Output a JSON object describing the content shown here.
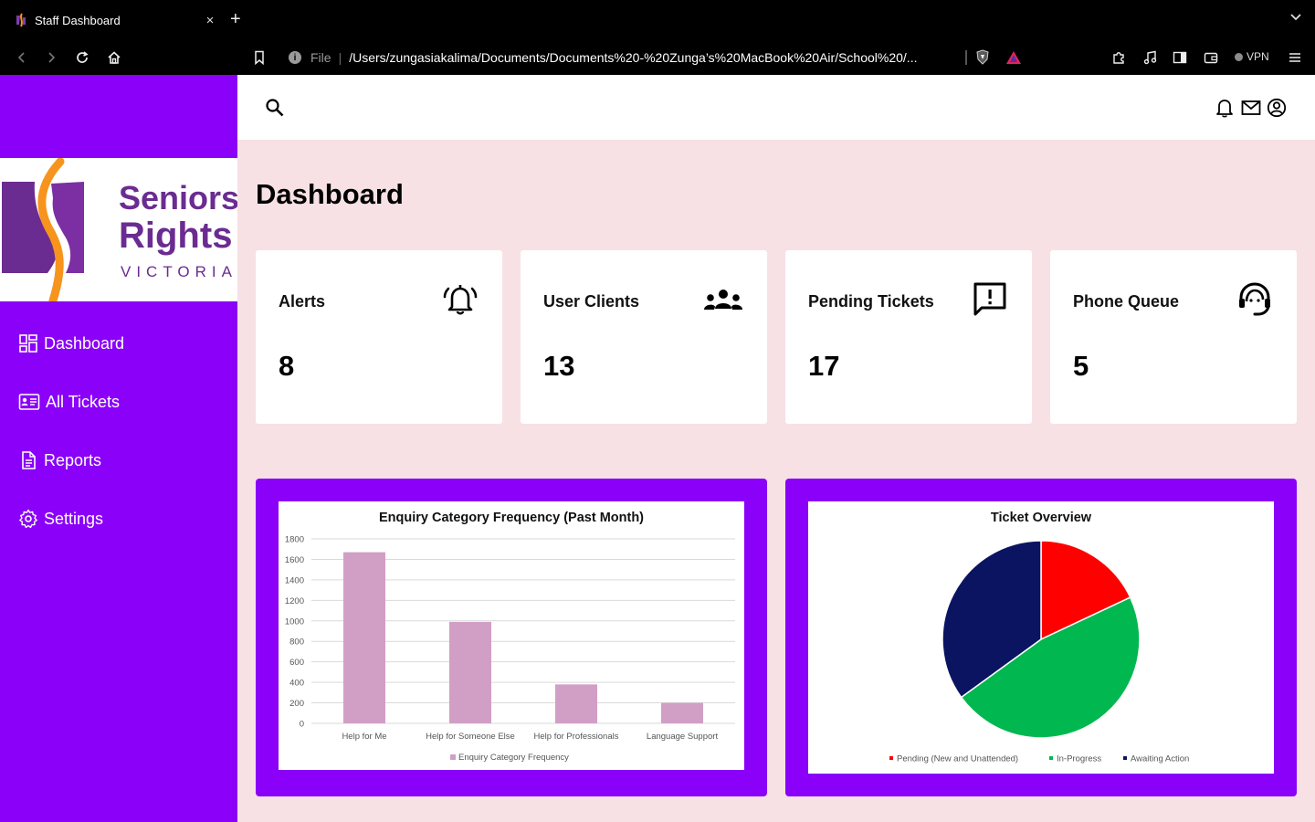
{
  "browser": {
    "tab_title": "Staff Dashboard",
    "tab_close": "×",
    "new_tab": "+",
    "url_scheme": "File",
    "url_separator": "|",
    "url_path": "/Users/zungasiakalima/Documents/Documents%20-%20Zunga’s%20MacBook%20Air/School%20/...",
    "vpn_label": "VPN"
  },
  "sidebar": {
    "logo": {
      "line1": "Seniors",
      "line2": "Rights",
      "line3": "VICTORIA"
    },
    "items": [
      {
        "label": "Dashboard",
        "icon": "dashboard-icon"
      },
      {
        "label": "All Tickets",
        "icon": "ticket-icon"
      },
      {
        "label": "Reports",
        "icon": "report-icon"
      },
      {
        "label": "Settings",
        "icon": "gear-icon"
      }
    ]
  },
  "main": {
    "title": "Dashboard",
    "cards": [
      {
        "title": "Alerts",
        "value": "8",
        "icon": "bell-ringing-icon"
      },
      {
        "title": "User Clients",
        "value": "13",
        "icon": "group-icon"
      },
      {
        "title": "Pending Tickets",
        "value": "17",
        "icon": "feedback-icon"
      },
      {
        "title": "Phone Queue",
        "value": "5",
        "icon": "headset-icon"
      }
    ]
  },
  "colors": {
    "sidebar": "#8a00f8",
    "background": "#f7e1e5",
    "bar": "#d19fc6",
    "pending": "#ff0000",
    "in_progress": "#00b84f",
    "awaiting": "#0b1461"
  },
  "chart_data": [
    {
      "type": "bar",
      "title": "Enquiry Category Frequency (Past Month)",
      "categories": [
        "Help for Me",
        "Help for Someone Else",
        "Help for Professionals",
        "Language Support"
      ],
      "series": [
        {
          "name": "Enquiry Category Frequency",
          "values": [
            1670,
            990,
            380,
            200
          ]
        }
      ],
      "ylim": [
        0,
        1800
      ],
      "yticks": [
        0,
        200,
        400,
        600,
        800,
        1000,
        1200,
        1400,
        1600,
        1800
      ],
      "grid": true,
      "legend": "bottom"
    },
    {
      "type": "pie",
      "title": "Ticket Overview",
      "labels": [
        "Pending (New and Unattended)",
        "In-Progress",
        "Awaiting Action"
      ],
      "values": [
        18,
        47,
        35
      ],
      "colors": [
        "#ff0000",
        "#00b84f",
        "#0b1461"
      ],
      "legend": "bottom"
    }
  ]
}
